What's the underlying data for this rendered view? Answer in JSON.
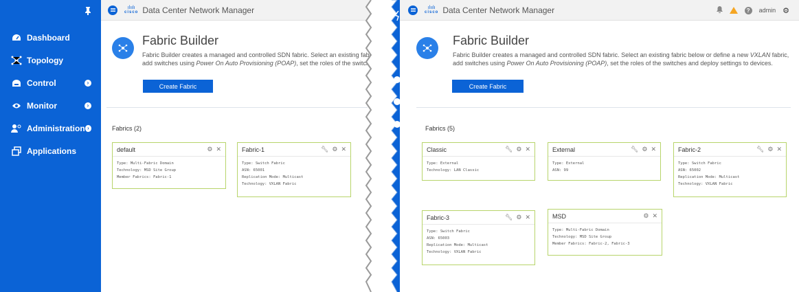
{
  "left": {
    "sidebar": {
      "pin_icon": "pin-icon",
      "items": [
        {
          "label": "Dashboard",
          "icon": "dashboard-icon",
          "has_chevron": false
        },
        {
          "label": "Topology",
          "icon": "topology-icon",
          "has_chevron": false
        },
        {
          "label": "Control",
          "icon": "control-icon",
          "has_chevron": true
        },
        {
          "label": "Monitor",
          "icon": "monitor-icon",
          "has_chevron": true
        },
        {
          "label": "Administration",
          "icon": "administration-icon",
          "has_chevron": true
        },
        {
          "label": "Applications",
          "icon": "applications-icon",
          "has_chevron": false
        }
      ]
    },
    "header": {
      "logo_top": "ılıılı",
      "logo_bottom": "cisco",
      "app_title": "Data Center Network Manager"
    },
    "hero": {
      "title": "Fabric Builder",
      "desc_line1": "Fabric Builder creates a managed and controlled SDN fabric. Select an existing fabri",
      "desc_line2_pre": "add switches using ",
      "desc_line2_em": "Power On Auto Provisioning (POAP)",
      "desc_line2_post": ", set the roles of the switch",
      "create_button": "Create Fabric"
    },
    "fabrics_header": "Fabrics (2)",
    "cards": [
      {
        "name": "default",
        "lines": [
          "Type: Multi-Fabric Domain",
          "Technology: MSD Site Group",
          "Member Fabrics: Fabric-1"
        ],
        "wrench": false
      },
      {
        "name": "Fabric-1",
        "lines": [
          "Type: Switch Fabric",
          "ASN: 65001",
          "Replication Mode: Multicast",
          "Technology: VXLAN Fabric"
        ],
        "wrench": true
      }
    ]
  },
  "right": {
    "header": {
      "logo_top": "ılıılı",
      "logo_bottom": "cisco",
      "app_title": "Data Center Network Manager",
      "user": "admin"
    },
    "hero": {
      "title": "Fabric Builder",
      "desc_line1_pre": "Fabric Builder creates a managed and controlled SDN fabric. Select an existing fabric below or define a new ",
      "desc_line1_em": "VXLAN",
      "desc_line1_post": " fabric,",
      "desc_line2_pre": "add switches using ",
      "desc_line2_em": "Power On Auto Provisioning (POAP)",
      "desc_line2_post": ", set the roles of the switches and deploy settings to devices.",
      "create_button": "Create Fabric"
    },
    "fabrics_header": "Fabrics (5)",
    "cards": [
      {
        "name": "Classic",
        "lines": [
          "Type: External",
          "Technology: LAN Classic"
        ],
        "wrench": true
      },
      {
        "name": "External",
        "lines": [
          "Type: External",
          "ASN: 99"
        ],
        "wrench": true
      },
      {
        "name": "Fabric-2",
        "lines": [
          "Type: Switch Fabric",
          "ASN: 65002",
          "Replication Mode: Multicast",
          "Technology: VXLAN Fabric"
        ],
        "wrench": true
      },
      {
        "name": "Fabric-3",
        "lines": [
          "Type: Switch Fabric",
          "ASN: 65003",
          "Replication Mode: Multicast",
          "Technology: VXLAN Fabric"
        ],
        "wrench": true
      },
      {
        "name": "MSD",
        "lines": [
          "Type: Multi-Fabric Domain",
          "Technology: MSD Site Group",
          "Member Fabrics: Fabric-2, Fabric-3"
        ],
        "wrench": false
      }
    ]
  },
  "colors": {
    "brand_blue": "#0b63d6",
    "card_border": "#b7d46a",
    "warning": "#f5a623"
  }
}
